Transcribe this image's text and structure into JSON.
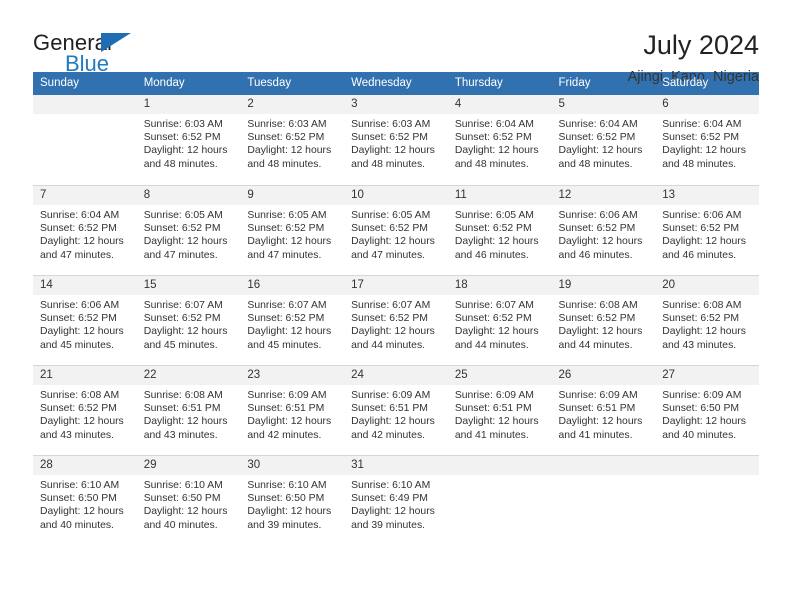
{
  "brand": {
    "name_part1": "General",
    "name_part2": "Blue",
    "accent_color": "#1f6eb4",
    "triangle_icon": "triangle-icon"
  },
  "header": {
    "title": "July 2024",
    "location": "Ajingi, Kano, Nigeria"
  },
  "theme": {
    "header_blue": "#3271b0",
    "date_band_gray": "#f2f2f2",
    "grid_line": "#d7d7d7"
  },
  "weekdays": [
    "Sunday",
    "Monday",
    "Tuesday",
    "Wednesday",
    "Thursday",
    "Friday",
    "Saturday"
  ],
  "labels": {
    "sunrise_prefix": "Sunrise:",
    "sunset_prefix": "Sunset:",
    "daylight_prefix": "Daylight:"
  },
  "weeks": [
    [
      {
        "day": "",
        "sunrise": "",
        "sunset": "",
        "daylight_line1": "",
        "daylight_line2": ""
      },
      {
        "day": "1",
        "sunrise": "Sunrise: 6:03 AM",
        "sunset": "Sunset: 6:52 PM",
        "daylight_line1": "Daylight: 12 hours",
        "daylight_line2": "and 48 minutes."
      },
      {
        "day": "2",
        "sunrise": "Sunrise: 6:03 AM",
        "sunset": "Sunset: 6:52 PM",
        "daylight_line1": "Daylight: 12 hours",
        "daylight_line2": "and 48 minutes."
      },
      {
        "day": "3",
        "sunrise": "Sunrise: 6:03 AM",
        "sunset": "Sunset: 6:52 PM",
        "daylight_line1": "Daylight: 12 hours",
        "daylight_line2": "and 48 minutes."
      },
      {
        "day": "4",
        "sunrise": "Sunrise: 6:04 AM",
        "sunset": "Sunset: 6:52 PM",
        "daylight_line1": "Daylight: 12 hours",
        "daylight_line2": "and 48 minutes."
      },
      {
        "day": "5",
        "sunrise": "Sunrise: 6:04 AM",
        "sunset": "Sunset: 6:52 PM",
        "daylight_line1": "Daylight: 12 hours",
        "daylight_line2": "and 48 minutes."
      },
      {
        "day": "6",
        "sunrise": "Sunrise: 6:04 AM",
        "sunset": "Sunset: 6:52 PM",
        "daylight_line1": "Daylight: 12 hours",
        "daylight_line2": "and 48 minutes."
      }
    ],
    [
      {
        "day": "7",
        "sunrise": "Sunrise: 6:04 AM",
        "sunset": "Sunset: 6:52 PM",
        "daylight_line1": "Daylight: 12 hours",
        "daylight_line2": "and 47 minutes."
      },
      {
        "day": "8",
        "sunrise": "Sunrise: 6:05 AM",
        "sunset": "Sunset: 6:52 PM",
        "daylight_line1": "Daylight: 12 hours",
        "daylight_line2": "and 47 minutes."
      },
      {
        "day": "9",
        "sunrise": "Sunrise: 6:05 AM",
        "sunset": "Sunset: 6:52 PM",
        "daylight_line1": "Daylight: 12 hours",
        "daylight_line2": "and 47 minutes."
      },
      {
        "day": "10",
        "sunrise": "Sunrise: 6:05 AM",
        "sunset": "Sunset: 6:52 PM",
        "daylight_line1": "Daylight: 12 hours",
        "daylight_line2": "and 47 minutes."
      },
      {
        "day": "11",
        "sunrise": "Sunrise: 6:05 AM",
        "sunset": "Sunset: 6:52 PM",
        "daylight_line1": "Daylight: 12 hours",
        "daylight_line2": "and 46 minutes."
      },
      {
        "day": "12",
        "sunrise": "Sunrise: 6:06 AM",
        "sunset": "Sunset: 6:52 PM",
        "daylight_line1": "Daylight: 12 hours",
        "daylight_line2": "and 46 minutes."
      },
      {
        "day": "13",
        "sunrise": "Sunrise: 6:06 AM",
        "sunset": "Sunset: 6:52 PM",
        "daylight_line1": "Daylight: 12 hours",
        "daylight_line2": "and 46 minutes."
      }
    ],
    [
      {
        "day": "14",
        "sunrise": "Sunrise: 6:06 AM",
        "sunset": "Sunset: 6:52 PM",
        "daylight_line1": "Daylight: 12 hours",
        "daylight_line2": "and 45 minutes."
      },
      {
        "day": "15",
        "sunrise": "Sunrise: 6:07 AM",
        "sunset": "Sunset: 6:52 PM",
        "daylight_line1": "Daylight: 12 hours",
        "daylight_line2": "and 45 minutes."
      },
      {
        "day": "16",
        "sunrise": "Sunrise: 6:07 AM",
        "sunset": "Sunset: 6:52 PM",
        "daylight_line1": "Daylight: 12 hours",
        "daylight_line2": "and 45 minutes."
      },
      {
        "day": "17",
        "sunrise": "Sunrise: 6:07 AM",
        "sunset": "Sunset: 6:52 PM",
        "daylight_line1": "Daylight: 12 hours",
        "daylight_line2": "and 44 minutes."
      },
      {
        "day": "18",
        "sunrise": "Sunrise: 6:07 AM",
        "sunset": "Sunset: 6:52 PM",
        "daylight_line1": "Daylight: 12 hours",
        "daylight_line2": "and 44 minutes."
      },
      {
        "day": "19",
        "sunrise": "Sunrise: 6:08 AM",
        "sunset": "Sunset: 6:52 PM",
        "daylight_line1": "Daylight: 12 hours",
        "daylight_line2": "and 44 minutes."
      },
      {
        "day": "20",
        "sunrise": "Sunrise: 6:08 AM",
        "sunset": "Sunset: 6:52 PM",
        "daylight_line1": "Daylight: 12 hours",
        "daylight_line2": "and 43 minutes."
      }
    ],
    [
      {
        "day": "21",
        "sunrise": "Sunrise: 6:08 AM",
        "sunset": "Sunset: 6:52 PM",
        "daylight_line1": "Daylight: 12 hours",
        "daylight_line2": "and 43 minutes."
      },
      {
        "day": "22",
        "sunrise": "Sunrise: 6:08 AM",
        "sunset": "Sunset: 6:51 PM",
        "daylight_line1": "Daylight: 12 hours",
        "daylight_line2": "and 43 minutes."
      },
      {
        "day": "23",
        "sunrise": "Sunrise: 6:09 AM",
        "sunset": "Sunset: 6:51 PM",
        "daylight_line1": "Daylight: 12 hours",
        "daylight_line2": "and 42 minutes."
      },
      {
        "day": "24",
        "sunrise": "Sunrise: 6:09 AM",
        "sunset": "Sunset: 6:51 PM",
        "daylight_line1": "Daylight: 12 hours",
        "daylight_line2": "and 42 minutes."
      },
      {
        "day": "25",
        "sunrise": "Sunrise: 6:09 AM",
        "sunset": "Sunset: 6:51 PM",
        "daylight_line1": "Daylight: 12 hours",
        "daylight_line2": "and 41 minutes."
      },
      {
        "day": "26",
        "sunrise": "Sunrise: 6:09 AM",
        "sunset": "Sunset: 6:51 PM",
        "daylight_line1": "Daylight: 12 hours",
        "daylight_line2": "and 41 minutes."
      },
      {
        "day": "27",
        "sunrise": "Sunrise: 6:09 AM",
        "sunset": "Sunset: 6:50 PM",
        "daylight_line1": "Daylight: 12 hours",
        "daylight_line2": "and 40 minutes."
      }
    ],
    [
      {
        "day": "28",
        "sunrise": "Sunrise: 6:10 AM",
        "sunset": "Sunset: 6:50 PM",
        "daylight_line1": "Daylight: 12 hours",
        "daylight_line2": "and 40 minutes."
      },
      {
        "day": "29",
        "sunrise": "Sunrise: 6:10 AM",
        "sunset": "Sunset: 6:50 PM",
        "daylight_line1": "Daylight: 12 hours",
        "daylight_line2": "and 40 minutes."
      },
      {
        "day": "30",
        "sunrise": "Sunrise: 6:10 AM",
        "sunset": "Sunset: 6:50 PM",
        "daylight_line1": "Daylight: 12 hours",
        "daylight_line2": "and 39 minutes."
      },
      {
        "day": "31",
        "sunrise": "Sunrise: 6:10 AM",
        "sunset": "Sunset: 6:49 PM",
        "daylight_line1": "Daylight: 12 hours",
        "daylight_line2": "and 39 minutes."
      },
      {
        "day": "",
        "sunrise": "",
        "sunset": "",
        "daylight_line1": "",
        "daylight_line2": ""
      },
      {
        "day": "",
        "sunrise": "",
        "sunset": "",
        "daylight_line1": "",
        "daylight_line2": ""
      },
      {
        "day": "",
        "sunrise": "",
        "sunset": "",
        "daylight_line1": "",
        "daylight_line2": ""
      }
    ]
  ]
}
